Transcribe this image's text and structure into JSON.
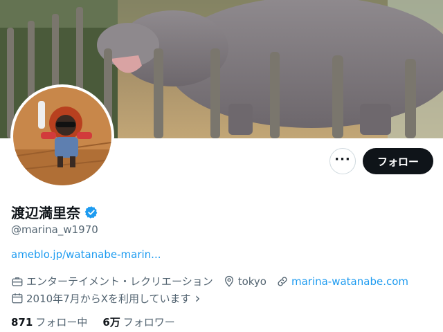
{
  "profile": {
    "display_name": "渡辺満里奈",
    "handle": "@marina_w1970",
    "bio_link": "ameblo.jp/watanabe-marin...",
    "category": "エンターテイメント・レクリエーション",
    "location": "tokyo",
    "website": "marina-watanabe.com",
    "joined": "2010年7月からXを利用しています",
    "joined_chevron": "›"
  },
  "actions": {
    "more_label": "···",
    "follow_label": "フォロー"
  },
  "stats": {
    "following_count": "871",
    "following_label": "フォロー中",
    "followers_count": "6万",
    "followers_label": "フォロワー"
  },
  "colors": {
    "accent": "#1d9bf0",
    "primary_button": "#0f1419",
    "secondary_text": "#536471"
  },
  "icons": [
    "verified-badge-icon",
    "more-icon",
    "briefcase-icon",
    "location-icon",
    "link-icon",
    "calendar-icon",
    "chevron-right-icon"
  ]
}
